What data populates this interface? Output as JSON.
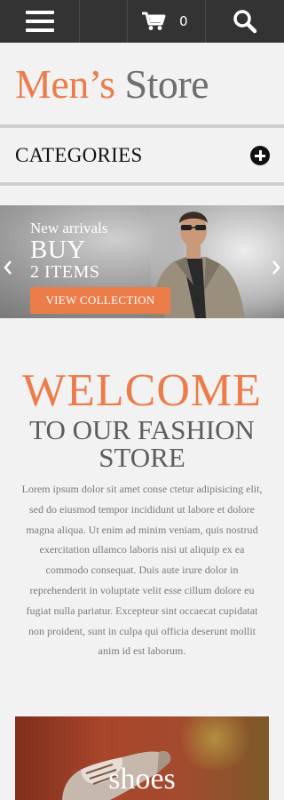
{
  "topbar": {
    "menu_icon": "hamburger-icon",
    "cart_icon": "cart-icon",
    "cart_count": "0",
    "search_icon": "search-icon"
  },
  "logo": {
    "part1": "Men’s",
    "part2": "Store"
  },
  "categories": {
    "label": "CATEGORIES",
    "toggle_icon": "plus-circle-icon"
  },
  "banner": {
    "line1": "New arrivals",
    "line2": "BUY",
    "line3": "2 ITEMS",
    "button": "VIEW COLLECTION",
    "prev_icon": "chevron-left-icon",
    "next_icon": "chevron-right-icon"
  },
  "welcome": {
    "title": "WELCOME",
    "subtitle_line1": "TO OUR FASHION",
    "subtitle_line2": "STORE",
    "body": "Lorem ipsum dolor sit amet conse ctetur adipisicing elit, sed do eiusmod tempor incididunt ut labore et dolore magna aliqua. Ut enim ad minim veniam, quis nostrud exercitation ullamco laboris nisi ut aliquip ex ea commodo consequat. Duis aute irure dolor in reprehenderit in voluptate velit esse cillum dolore eu fugiat nulla pariatur. Excepteur sint occaecat cupidatat non proident, sunt in culpa qui officia deserunt mollit anim id est laborum."
  },
  "promo": {
    "label": "shoes"
  },
  "colors": {
    "accent": "#ec7c4a",
    "topbar": "#333333",
    "background": "#f2f2f2"
  }
}
